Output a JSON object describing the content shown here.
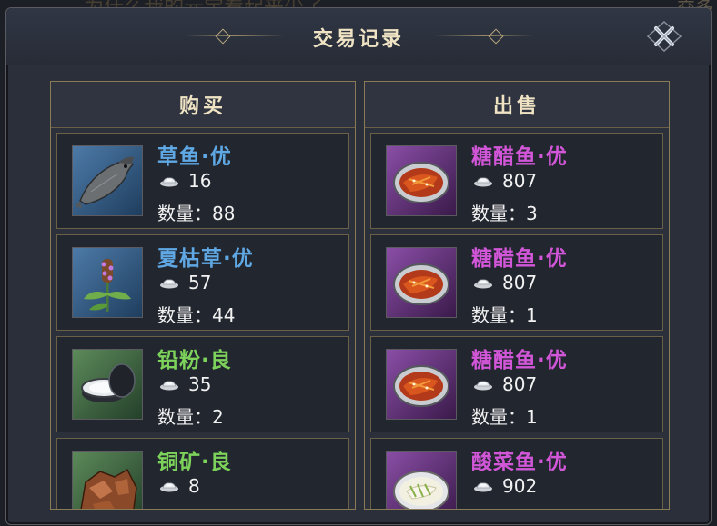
{
  "background_text": "为什么我的元宝看起来少了",
  "background_text_right": "交多",
  "dialog": {
    "title": "交易记录",
    "close_icon": "close-x-icon"
  },
  "buy": {
    "header": "购买",
    "items": [
      {
        "name": "草鱼·优",
        "price": "16",
        "qty": "数量：88",
        "icon": "grass-carp-icon",
        "rarity": "blue"
      },
      {
        "name": "夏枯草·优",
        "price": "57",
        "qty": "数量：44",
        "icon": "selfheal-herb-icon",
        "rarity": "blue"
      },
      {
        "name": "铅粉·良",
        "price": "35",
        "qty": "数量：2",
        "icon": "lead-powder-jar-icon",
        "rarity": "green"
      },
      {
        "name": "铜矿·良",
        "price": "8",
        "qty": "",
        "icon": "copper-ore-icon",
        "rarity": "green"
      }
    ]
  },
  "sell": {
    "header": "出售",
    "items": [
      {
        "name": "糖醋鱼·优",
        "price": "807",
        "qty": "数量：3",
        "icon": "sweet-sour-fish-icon",
        "rarity": "purple"
      },
      {
        "name": "糖醋鱼·优",
        "price": "807",
        "qty": "数量：1",
        "icon": "sweet-sour-fish-icon",
        "rarity": "purple"
      },
      {
        "name": "糖醋鱼·优",
        "price": "807",
        "qty": "数量：1",
        "icon": "sweet-sour-fish-icon",
        "rarity": "purple"
      },
      {
        "name": "酸菜鱼·优",
        "price": "902",
        "qty": "",
        "icon": "pickled-fish-icon",
        "rarity": "purple"
      }
    ]
  },
  "colors": {
    "blue": "#5fa8e4",
    "green": "#7cd25a",
    "purple": "#d256d8",
    "gold_border": "#8a7a55"
  },
  "currency_icon": "silver-ingot-icon"
}
